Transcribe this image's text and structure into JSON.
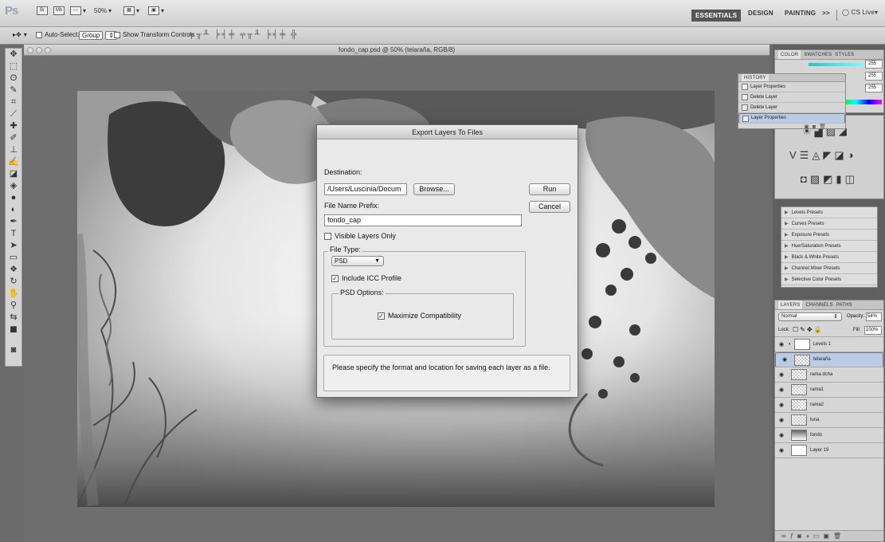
{
  "appbar": {
    "logo": "Ps",
    "br_label": "Br",
    "mb_label": "Mb",
    "zoom": "50%",
    "workspaces": [
      "ESSENTIALS",
      "DESIGN",
      "PAINTING",
      ">>"
    ],
    "cslive": "CS Live"
  },
  "options": {
    "auto_select": "Auto-Select:",
    "group_value": "Group",
    "show_transform": "Show Transform Controls"
  },
  "document": {
    "title": "fondo_cap.psd @ 50% (telaraña, RGB/8)"
  },
  "dialog": {
    "title": "Export Layers To Files",
    "destination_label": "Destination:",
    "destination_value": "/Users/Luscinia/Docum",
    "browse": "Browse...",
    "run": "Run",
    "cancel": "Cancel",
    "prefix_label": "File Name Prefix:",
    "prefix_value": "fondo_cap",
    "visible_only": "Visible Layers Only",
    "file_type_label": "File Type:",
    "file_type_value": "PSD",
    "include_icc": "Include ICC Profile",
    "psd_options_label": "PSD Options:",
    "max_compat": "Maximize Compatibility",
    "info": "Please specify the format and location for saving each layer as a file."
  },
  "panels": {
    "color_tabs": [
      "COLOR",
      "SWATCHES",
      "STYLES"
    ],
    "color_values": [
      "255",
      "255",
      "255"
    ],
    "history_title": "HISTORY",
    "history_items": [
      "Layer Properties",
      "Delete Layer",
      "Delete Layer",
      "Layer Properties"
    ],
    "adjustment_presets": [
      "Levels Presets",
      "Curves Presets",
      "Exposure Presets",
      "Hue/Saturation Presets",
      "Black & White Presets",
      "Channel Mixer Presets",
      "Selective Color Presets"
    ],
    "layers_tabs": [
      "LAYERS",
      "CHANNELS",
      "PATHS"
    ],
    "blend_mode": "Normal",
    "opacity_label": "Opacity:",
    "opacity_value": "54%",
    "lock_label": "Lock:",
    "fill_label": "Fill:",
    "fill_value": "100%",
    "layers": [
      "Levels 1",
      "telaraña",
      "rama dcha",
      "rama1",
      "rama2",
      "luna",
      "fondo",
      "Layer 19"
    ]
  }
}
